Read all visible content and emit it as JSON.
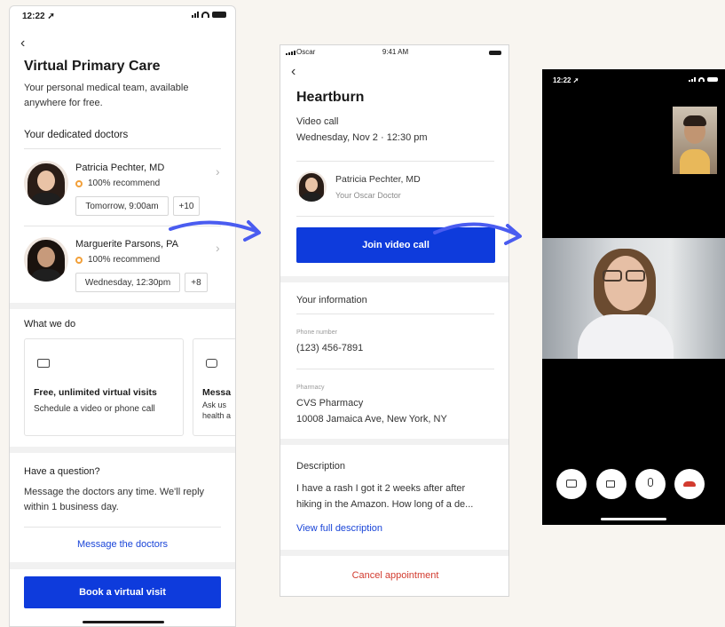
{
  "screen1": {
    "time": "12:22 ➚",
    "title": "Virtual Primary Care",
    "subtitle_line1": "Your personal medical team, available",
    "subtitle_line2": "anywhere for free.",
    "doctors_heading": "Your dedicated doctors",
    "doctors": [
      {
        "name": "Patricia Pechter, MD",
        "recommend": "100% recommend",
        "slot": "Tomorrow, 9:00am",
        "more": "+10"
      },
      {
        "name": "Marguerite Parsons, PA",
        "recommend": "100% recommend",
        "slot": "Wednesday, 12:30pm",
        "more": "+8"
      }
    ],
    "what_we_do": "What we do",
    "card1_title": "Free, unlimited virtual visits",
    "card1_desc": "Schedule a video or phone call",
    "card2_title": "Messa",
    "card2_desc1": "Ask us",
    "card2_desc2": "health a",
    "question_heading": "Have a question?",
    "question_line1": "Message the doctors any time. We'll reply",
    "question_line2": "within 1 business day.",
    "message_link": "Message the doctors",
    "book_button": "Book a virtual visit"
  },
  "screen2": {
    "carrier": "Oscar",
    "time": "9:41 AM",
    "title": "Heartburn",
    "visit_type": "Video call",
    "visit_date": "Wednesday, Nov 2 · 12:30 pm",
    "doctor_name": "Patricia Pechter, MD",
    "doctor_role": "Your Oscar Doctor",
    "join_button": "Join video call",
    "your_info": "Your information",
    "phone_label": "Phone number",
    "phone": "(123) 456-7891",
    "pharmacy_label": "Pharmacy",
    "pharmacy_name": "CVS Pharmacy",
    "pharmacy_address": "10008 Jamaica Ave, New York, NY",
    "description_heading": "Description",
    "description_line1": "I have a rash I got it 2 weeks after after",
    "description_line2": "hiking in the Amazon. How long of a de...",
    "view_full": "View full description",
    "cancel": "Cancel appointment"
  },
  "screen3": {
    "time": "12:22 ➚"
  },
  "colors": {
    "accent": "#0e3bdc",
    "link": "#1a45d8",
    "arrow": "#4a5cf0",
    "cancel": "#d23b2f",
    "recommend": "#f2a03a"
  }
}
